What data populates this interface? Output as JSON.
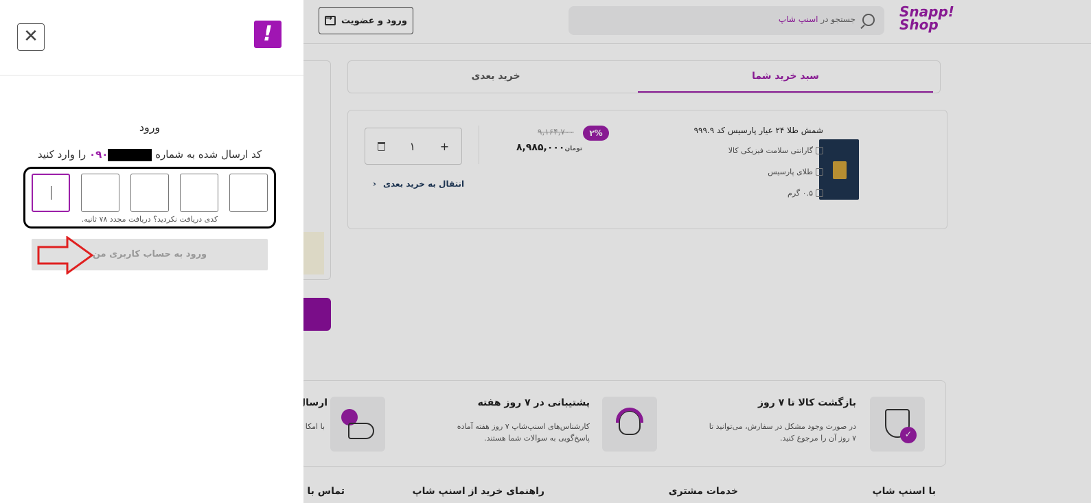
{
  "header": {
    "logo_line1": "Snapp!",
    "logo_line2": "Shop",
    "search_placeholder": "جستجو در",
    "search_brand": "اسنپ شاپ",
    "login_button": "ورود و عضویت"
  },
  "tabs": {
    "cart": "سبد خرید شما",
    "next_purchase": "خرید بعدی"
  },
  "cart_item": {
    "name": "شمش طلا ۲۴ عیار پارسیس کد ۹۹۹.۹",
    "warranty": "گارانتی سلامت فیزیکی کالا",
    "seller": "طلای پارسیس",
    "weight": "۰.۵ گرم",
    "discount": "۲%",
    "old_price": "۹,۱۶۴,۷۰۰",
    "new_price": "۸,۹۸۵,۰۰۰",
    "currency": "تومان",
    "quantity": "۱",
    "plus": "+",
    "move_to_next": "انتقال به خرید بعدی"
  },
  "features": [
    {
      "title": "بازگشت کالا تا ۷ روز",
      "desc": "در صورت وجود مشکل در سفارش، می‌توانید تا ۷ روز آن را مرجوع کنید."
    },
    {
      "title": "پشتیبانی در ۷ روز هفته",
      "desc": "کارشناس‌های اسنپ‌شاپ ۷ روز هفته آماده پاسخ‌گویی به سوالات شما هستند."
    },
    {
      "title": "ارسال",
      "desc": "با امکا ۳ ساع"
    }
  ],
  "footer": {
    "col1": "با اسنپ شاپ",
    "col2": "خدمات مشتری",
    "col3": "راهنمای خرید از اسنپ شاپ",
    "col4": "تماس با"
  },
  "drawer": {
    "close_symbol": "✕",
    "brand_symbol": "!",
    "title": "ورود",
    "subtitle_before": "کد ارسال شده به شماره",
    "phone_prefix": "۰۹۰",
    "subtitle_after": "را وارد کنید",
    "resend_text": "کدی دریافت نکردید؟ دریافت مجدد ۷۸ ثانیه.",
    "submit_button": "ورود به حساب کاربری من"
  },
  "colors": {
    "brand": "#9b1ea8",
    "annotation": "#e02020"
  }
}
